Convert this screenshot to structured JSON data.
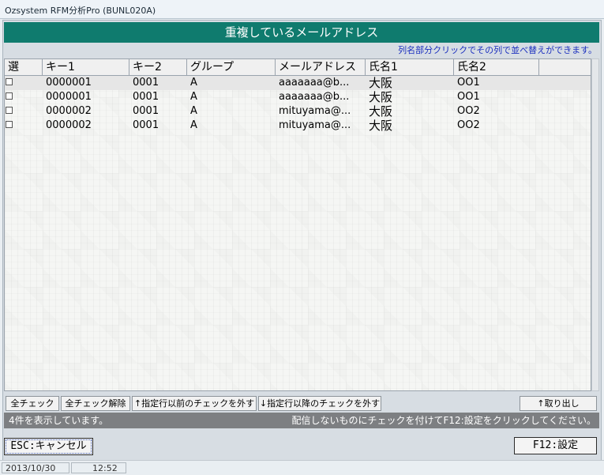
{
  "window": {
    "title": "Ozsystem RFM分析Pro (BUNL020A)"
  },
  "header": {
    "title": "重複しているメールアドレス"
  },
  "hint": "列名部分クリックでその列で並べ替えができます。",
  "table": {
    "columns": [
      "選",
      "キー1",
      "キー2",
      "グループ",
      "メールアドレス",
      "氏名1",
      "氏名2"
    ],
    "rows": [
      {
        "checked": false,
        "key1": "0000001",
        "key2": "0001",
        "group": "A",
        "email": "aaaaaaa@b...",
        "name1": "大阪",
        "name2": "OO1"
      },
      {
        "checked": false,
        "key1": "0000001",
        "key2": "0001",
        "group": "A",
        "email": "aaaaaaa@b...",
        "name1": "大阪",
        "name2": "OO1"
      },
      {
        "checked": false,
        "key1": "0000002",
        "key2": "0001",
        "group": "A",
        "email": "mituyama@...",
        "name1": "大阪",
        "name2": "OO2"
      },
      {
        "checked": false,
        "key1": "0000002",
        "key2": "0001",
        "group": "A",
        "email": "mituyama@...",
        "name1": "大阪",
        "name2": "OO2"
      }
    ]
  },
  "toolbar": {
    "check_all": "全チェック",
    "uncheck_all": "全チェック解除",
    "uncheck_before": "↑指定行以前のチェックを外す",
    "uncheck_after": "↓指定行以降のチェックを外す",
    "take_out": "↑取り出し"
  },
  "status": {
    "count": "4件を表示しています。",
    "instruction": "配信しないものにチェックを付けてF12:設定をクリックしてください。"
  },
  "buttons": {
    "cancel": "ESC:キャンセル",
    "set": "F12:設定"
  },
  "footer": {
    "date": "2013/10/30",
    "time": "12:52"
  }
}
